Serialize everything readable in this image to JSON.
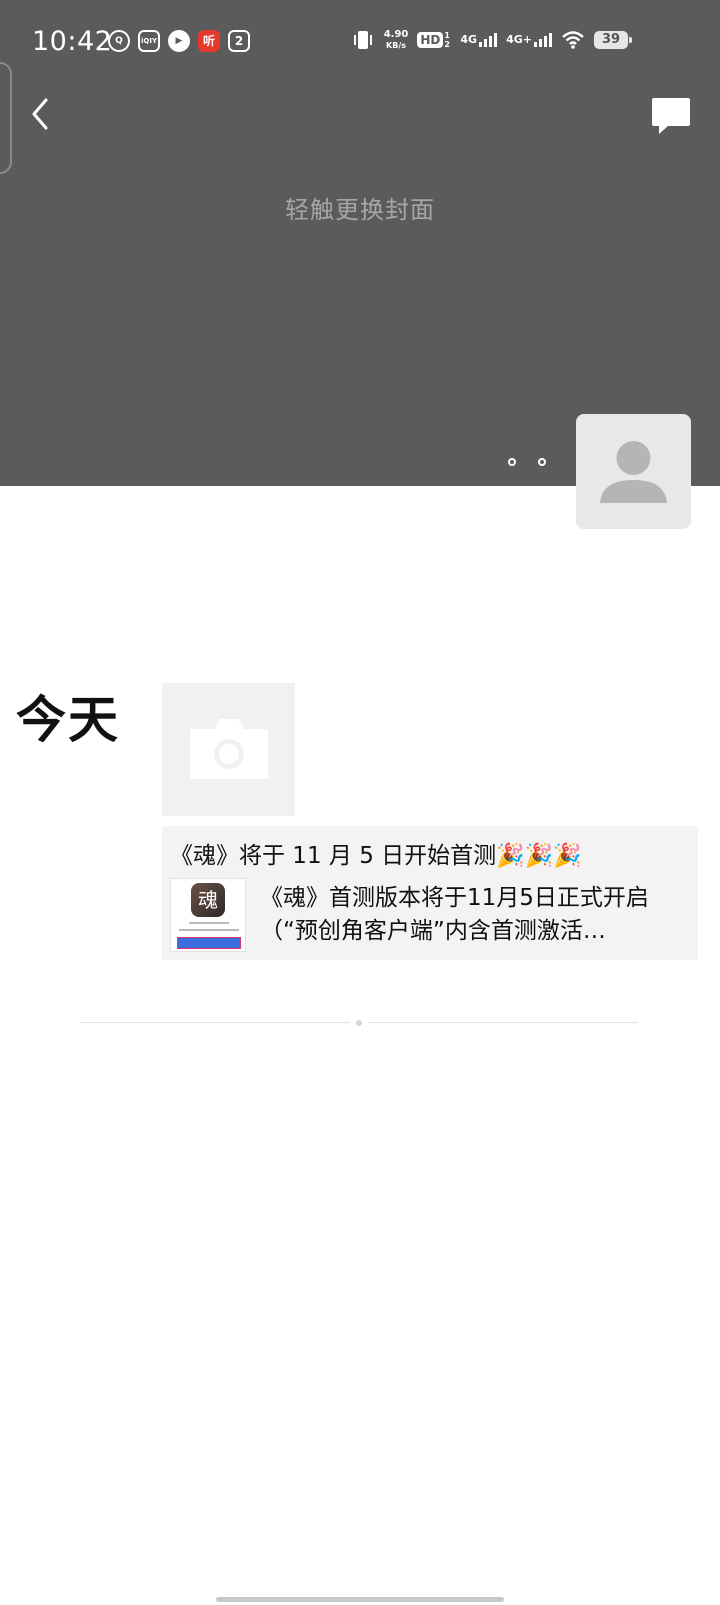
{
  "status_bar": {
    "time": "10:42",
    "app_icons": [
      {
        "name": "qq-icon",
        "glyph": "Q"
      },
      {
        "name": "iqiyi-icon",
        "glyph": "iQIY"
      },
      {
        "name": "video-play-icon",
        "glyph": "▶"
      },
      {
        "name": "ting-icon",
        "glyph": "听"
      },
      {
        "name": "reader-icon",
        "glyph": "2"
      }
    ],
    "net_speed": "4.90",
    "net_speed_unit": "KB/s",
    "hd_label": "HD",
    "hd_sub": "1 2",
    "sim1": "4G",
    "sim2": "4G+",
    "battery": "39"
  },
  "cover": {
    "hint": "轻触更换封面",
    "bg_color": "#5b5b5b"
  },
  "timeline": {
    "day_label": "今天",
    "post": {
      "title": "《魂》将于 11 月 5 日开始首测🎉🎉🎉",
      "desc_line1": "《魂》首测版本将于11月5日正式开启",
      "desc_line2": "（“预创角客户端”内含首测激活…",
      "thumb_logo": "魂"
    }
  }
}
